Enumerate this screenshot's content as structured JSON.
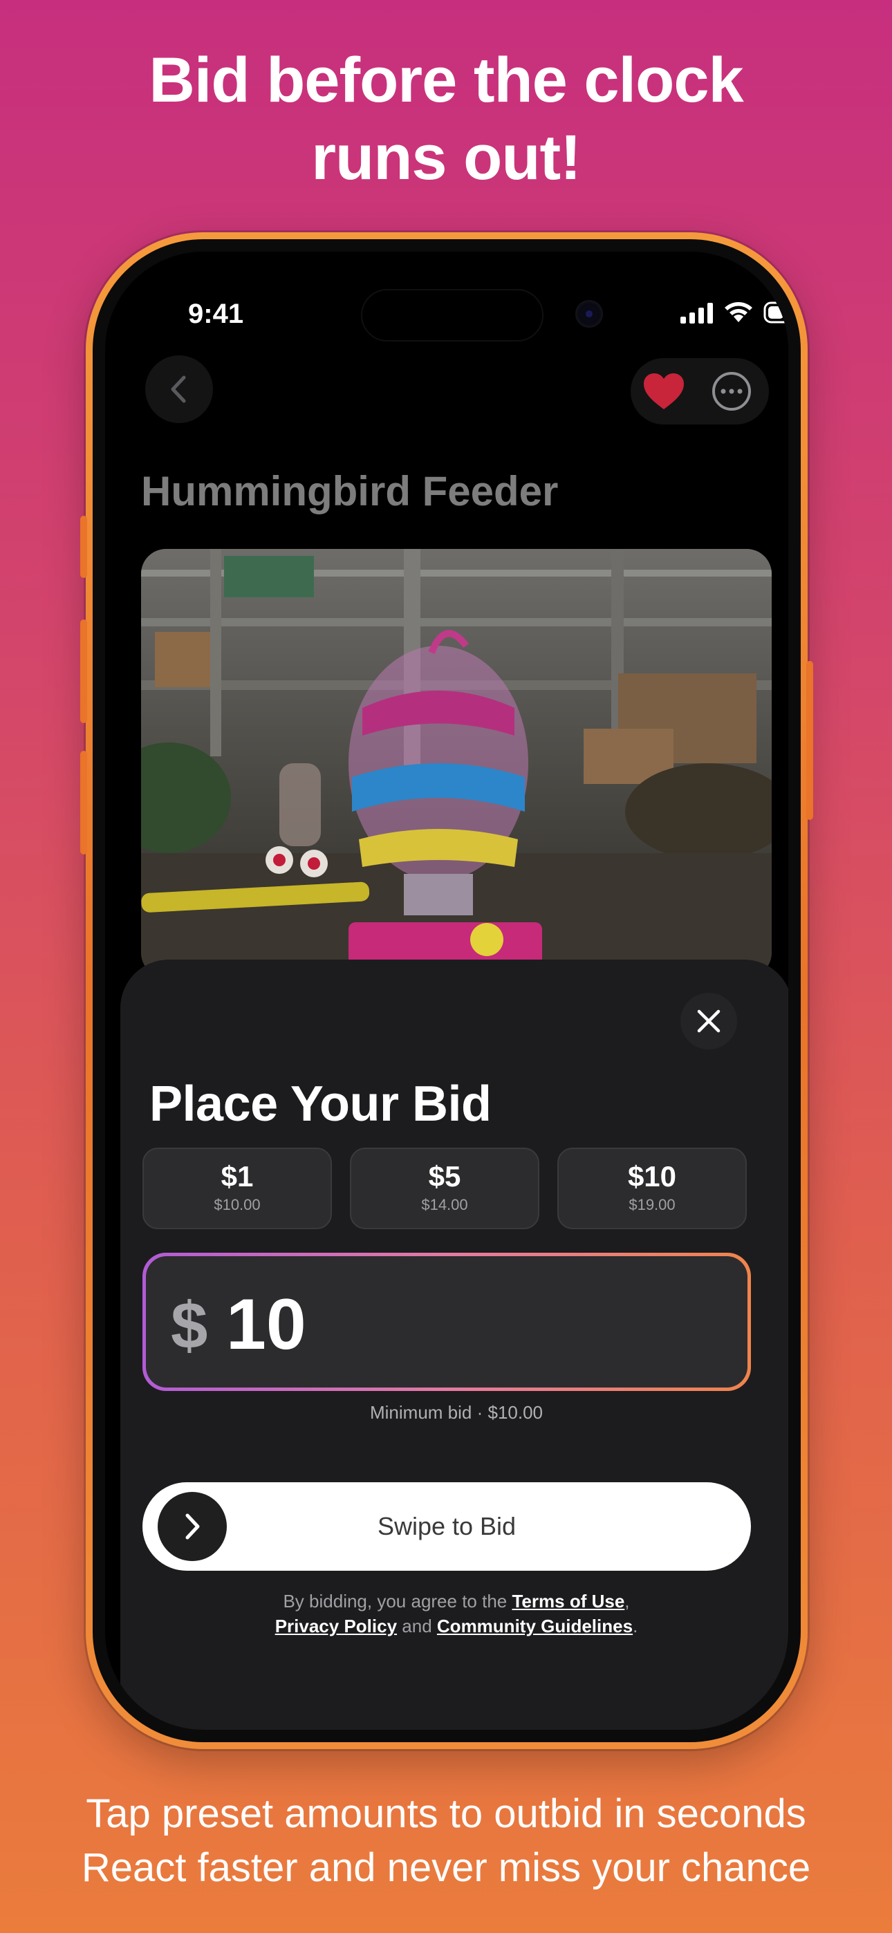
{
  "headline": {
    "line1": "Bid before the clock",
    "line2": "runs out!"
  },
  "footer": {
    "line1": "Tap preset amounts to outbid in seconds",
    "line2": "React faster and never miss your chance"
  },
  "status_bar": {
    "time": "9:41",
    "icons": [
      "signal-icon",
      "wifi-icon",
      "battery-icon"
    ]
  },
  "nav": {
    "back_icon": "chevron-left-icon",
    "favorite_icon": "heart-icon",
    "favorite_color": "#c8243a",
    "more_icon": "ellipsis-circle-icon"
  },
  "item": {
    "title": "Hummingbird Feeder"
  },
  "bid_sheet": {
    "title": "Place Your Bid",
    "presets": [
      {
        "amount": "$1",
        "total": "$10.00"
      },
      {
        "amount": "$5",
        "total": "$14.00"
      },
      {
        "amount": "$10",
        "total": "$19.00"
      }
    ],
    "currency_symbol": "$",
    "bid_value": "10",
    "min_bid_label": "Minimum bid",
    "min_bid_value": "$10.00",
    "swipe_label": "Swipe to Bid",
    "legal": {
      "prefix": "By bidding, you agree to the",
      "terms": "Terms of Use",
      "privacy": "Privacy Policy",
      "and": "and",
      "guidelines": "Community Guidelines"
    }
  },
  "colors": {
    "accent_gradient_start": "#b15cd6",
    "accent_gradient_end": "#f0844c",
    "phone_frame": "#ec7e2e"
  }
}
